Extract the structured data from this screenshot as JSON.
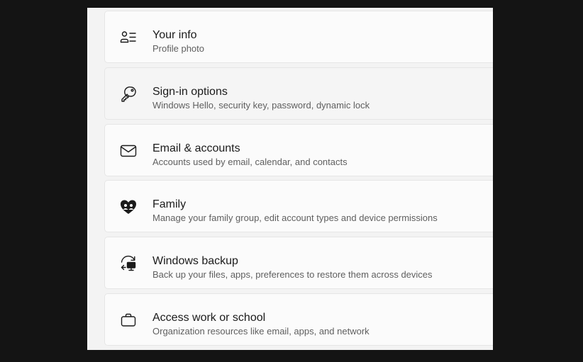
{
  "settings": {
    "items": [
      {
        "title": "Your info",
        "description": "Profile photo",
        "icon": "person-details-icon"
      },
      {
        "title": "Sign-in options",
        "description": "Windows Hello, security key, password, dynamic lock",
        "icon": "key-icon"
      },
      {
        "title": "Email & accounts",
        "description": "Accounts used by email, calendar, and contacts",
        "icon": "mail-icon"
      },
      {
        "title": "Family",
        "description": "Manage your family group, edit account types and device permissions",
        "icon": "family-heart-icon"
      },
      {
        "title": "Windows backup",
        "description": "Back up your files, apps, preferences to restore them across devices",
        "icon": "backup-sync-icon"
      },
      {
        "title": "Access work or school",
        "description": "Organization resources like email, apps, and network",
        "icon": "briefcase-icon"
      }
    ]
  }
}
